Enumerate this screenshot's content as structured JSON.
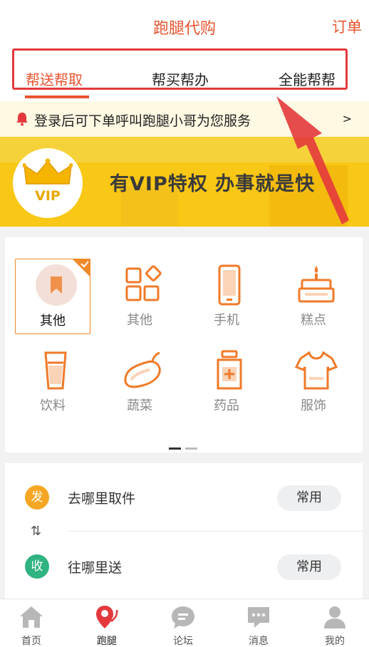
{
  "header": {
    "title": "跑腿代购",
    "order_label": "订单"
  },
  "tabs": [
    {
      "label": "帮送帮取",
      "active": true
    },
    {
      "label": "帮买帮办",
      "active": false
    },
    {
      "label": "全能帮帮",
      "active": false
    }
  ],
  "notice": {
    "text": "登录后可下单呼叫跑腿小哥为您服务",
    "chevron": ">"
  },
  "banner": {
    "badge_text": "VIP",
    "slogan": "有VIP特权 办事就是快"
  },
  "categories": [
    {
      "label": "其他",
      "icon": "bookmark-icon",
      "selected": true
    },
    {
      "label": "其他",
      "icon": "grid-icon",
      "selected": false
    },
    {
      "label": "手机",
      "icon": "phone-icon",
      "selected": false
    },
    {
      "label": "糕点",
      "icon": "cake-icon",
      "selected": false
    },
    {
      "label": "饮料",
      "icon": "cup-icon",
      "selected": false
    },
    {
      "label": "蔬菜",
      "icon": "eggplant-icon",
      "selected": false
    },
    {
      "label": "药品",
      "icon": "medicine-icon",
      "selected": false
    },
    {
      "label": "服饰",
      "icon": "tshirt-icon",
      "selected": false
    }
  ],
  "pager": {
    "active_page": 1,
    "total_pages": 2
  },
  "address": {
    "pickup": {
      "badge": "发",
      "text": "去哪里取件",
      "button": "常用"
    },
    "dropoff": {
      "badge": "收",
      "text": "往哪里送",
      "button": "常用"
    }
  },
  "nav": [
    {
      "label": "首页",
      "icon": "home-icon",
      "active": false
    },
    {
      "label": "跑腿",
      "icon": "location-pin-icon",
      "active": true
    },
    {
      "label": "论坛",
      "icon": "chat-bubble-icon",
      "active": false
    },
    {
      "label": "消息",
      "icon": "message-icon",
      "active": false
    },
    {
      "label": "我的",
      "icon": "user-icon",
      "active": false
    }
  ],
  "colors": {
    "accent": "#e8542f",
    "icon_orange": "#f07a28",
    "banner_yellow": "#f9c715",
    "annotation_red": "#e4393c",
    "pickup_badge": "#f5a623",
    "dropoff_badge": "#2fb380"
  }
}
